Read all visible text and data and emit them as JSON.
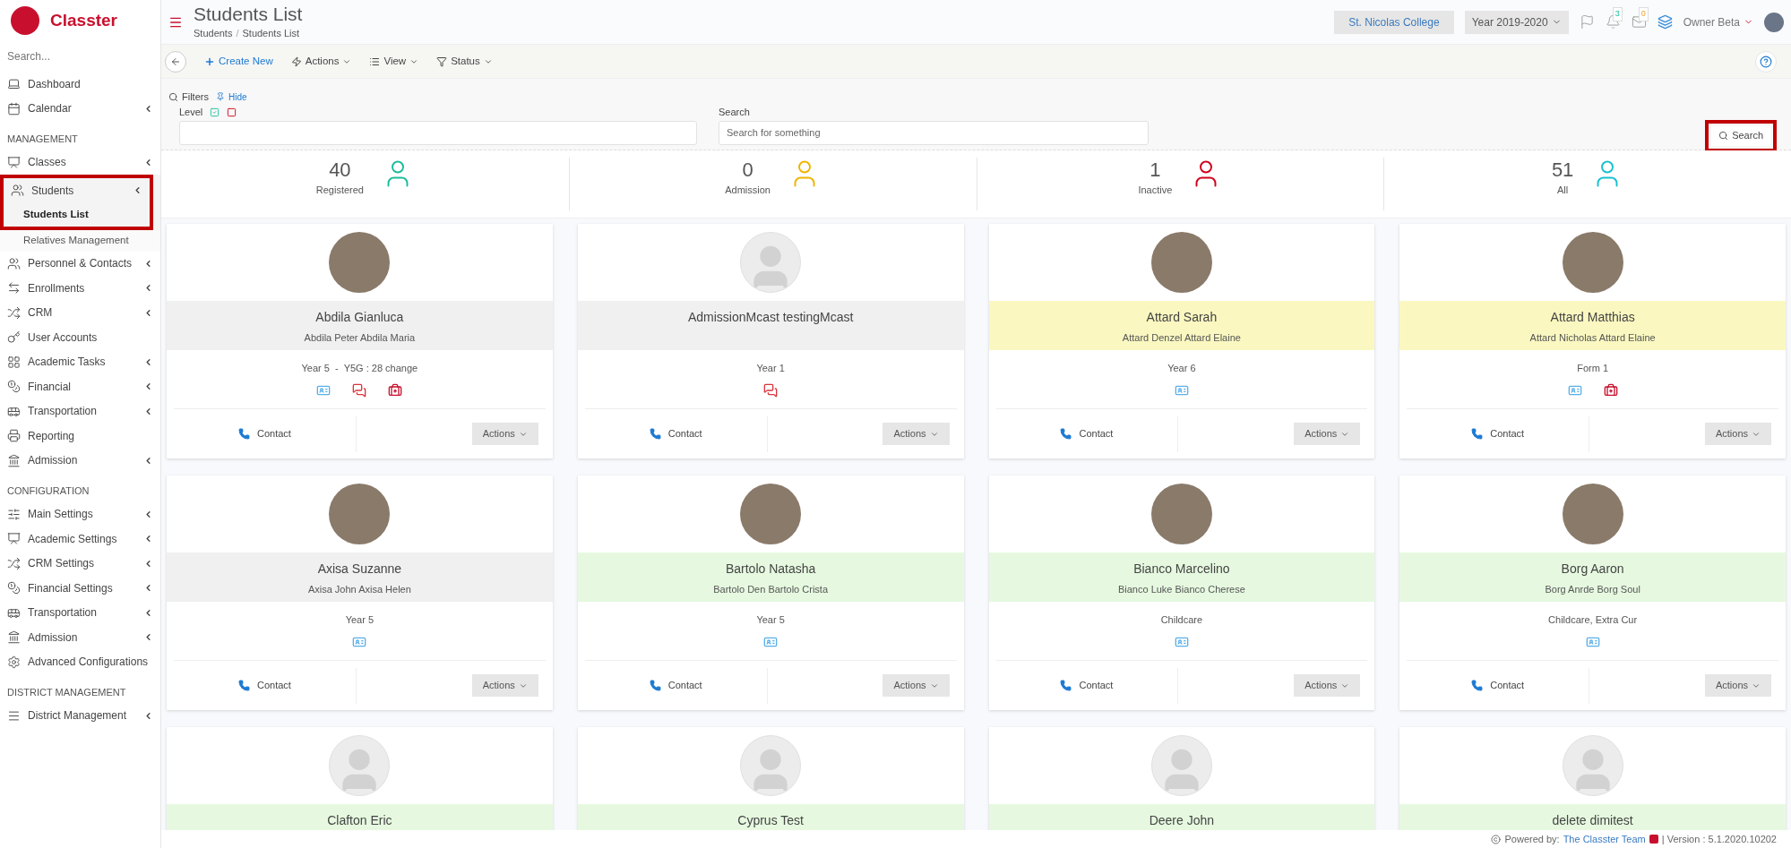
{
  "sidebar": {
    "brand": "Classter",
    "search_placeholder": "Search...",
    "sections": [
      {
        "items": [
          {
            "label": "Dashboard",
            "expandable": false
          },
          {
            "label": "Calendar",
            "expandable": true
          }
        ]
      },
      {
        "heading": "MANAGEMENT",
        "items": [
          {
            "label": "Classes",
            "expandable": true
          },
          {
            "label": "Students",
            "expandable": true,
            "highlighted": true,
            "children": [
              {
                "label": "Students List",
                "selected": true
              },
              {
                "label": "Relatives Management",
                "selected": false
              }
            ]
          },
          {
            "label": "Personnel & Contacts",
            "expandable": true
          },
          {
            "label": "Enrollments",
            "expandable": true
          },
          {
            "label": "CRM",
            "expandable": true
          },
          {
            "label": "User Accounts",
            "expandable": false
          },
          {
            "label": "Academic Tasks",
            "expandable": true
          },
          {
            "label": "Financial",
            "expandable": true
          },
          {
            "label": "Transportation",
            "expandable": true
          },
          {
            "label": "Reporting",
            "expandable": false
          },
          {
            "label": "Admission",
            "expandable": true
          }
        ]
      },
      {
        "heading": "CONFIGURATION",
        "items": [
          {
            "label": "Main Settings",
            "expandable": true
          },
          {
            "label": "Academic Settings",
            "expandable": true
          },
          {
            "label": "CRM Settings",
            "expandable": true
          },
          {
            "label": "Financial Settings",
            "expandable": true
          },
          {
            "label": "Transportation",
            "expandable": true
          },
          {
            "label": "Admission",
            "expandable": true
          },
          {
            "label": "Advanced Configurations",
            "expandable": false
          }
        ]
      },
      {
        "heading": "DISTRICT MANAGEMENT",
        "items": [
          {
            "label": "District Management",
            "expandable": true
          }
        ]
      }
    ]
  },
  "header": {
    "title": "Students List",
    "breadcrumb": [
      "Students",
      "Students List"
    ],
    "breadcrumb_separator": "/",
    "school": "St. Nicolas College",
    "year": "Year 2019-2020",
    "notifications": "3",
    "messages": "0",
    "user": "Owner Beta"
  },
  "toolbar": {
    "items": [
      "Create New",
      "Actions",
      "View",
      "Status"
    ]
  },
  "filters": {
    "title": "Filters",
    "hide": "Hide",
    "level_label": "Level",
    "search_label": "Search",
    "search_placeholder": "Search for something",
    "search_button": "Search",
    "search_highlighted": true
  },
  "stats": [
    {
      "value": "40",
      "label": "Registered",
      "color": "#1abc9c"
    },
    {
      "value": "0",
      "label": "Admission",
      "color": "#f0b400"
    },
    {
      "value": "1",
      "label": "Inactive",
      "color": "#d0021b"
    },
    {
      "value": "51",
      "label": "All",
      "color": "#17c1d0"
    }
  ],
  "cards": [
    {
      "name": "Abdila Gianluca",
      "guardians": "Abdila Peter Abdila Maria",
      "class": "Year 5  -  Y5G : 28 change",
      "photo": {
        "kind": "photo"
      },
      "color": "#f0f0f0",
      "icons": [
        {
          "kind": "id-card"
        },
        {
          "kind": "chat"
        },
        {
          "kind": "medical"
        }
      ],
      "contact": "Contact",
      "actions": "Actions"
    },
    {
      "name": "AdmissionMcast testingMcast",
      "class": "Year 1",
      "photo": {
        "kind": "placeholder"
      },
      "color": "#f0f0f0",
      "icons": [
        {
          "kind": "chat"
        }
      ],
      "contact": "Contact",
      "actions": "Actions"
    },
    {
      "name": "Attard Sarah",
      "guardians": "Attard Denzel Attard Elaine",
      "class": "Year 6",
      "photo": {
        "kind": "photo"
      },
      "color": "#faf8c0",
      "icons": [
        {
          "kind": "id-card"
        }
      ],
      "contact": "Contact",
      "actions": "Actions"
    },
    {
      "name": "Attard Matthias",
      "guardians": "Attard Nicholas Attard Elaine",
      "class": "Form 1",
      "photo": {
        "kind": "photo"
      },
      "color": "#faf8c0",
      "icons": [
        {
          "kind": "id-card"
        },
        {
          "kind": "medical"
        }
      ],
      "contact": "Contact",
      "actions": "Actions"
    },
    {
      "name": "Axisa Suzanne",
      "guardians": "Axisa John Axisa Helen",
      "class": "Year 5",
      "photo": {
        "kind": "photo"
      },
      "color": "#f0f0f0",
      "icons": [
        {
          "kind": "id-card"
        }
      ],
      "contact": "Contact",
      "actions": "Actions"
    },
    {
      "name": "Bartolo Natasha",
      "guardians": "Bartolo Den Bartolo Crista",
      "class": "Year 5",
      "photo": {
        "kind": "photo"
      },
      "color": "#e6f9e0",
      "icons": [
        {
          "kind": "id-card"
        }
      ],
      "contact": "Contact",
      "actions": "Actions"
    },
    {
      "name": "Bianco Marcelino",
      "guardians": "Bianco Luke Bianco Cherese",
      "class": "Childcare",
      "photo": {
        "kind": "photo"
      },
      "color": "#e6f9e0",
      "icons": [
        {
          "kind": "id-card"
        }
      ],
      "contact": "Contact",
      "actions": "Actions"
    },
    {
      "name": "Borg Aaron",
      "guardians": "Borg Anrde Borg Soul",
      "class": "Childcare, Extra Cur",
      "photo": {
        "kind": "photo"
      },
      "color": "#e6f9e0",
      "icons": [
        {
          "kind": "id-card"
        }
      ],
      "contact": "Contact",
      "actions": "Actions"
    },
    {
      "name": "Clafton Eric",
      "photo": {
        "kind": "placeholder"
      },
      "color": "#e6f9e0"
    },
    {
      "name": "Cyprus Test",
      "photo": {
        "kind": "placeholder"
      },
      "color": "#e6f9e0"
    },
    {
      "name": "Deere John",
      "photo": {
        "kind": "placeholder"
      },
      "color": "#e6f9e0"
    },
    {
      "name": "delete dimitest",
      "photo": {
        "kind": "placeholder"
      },
      "color": "#e6f9e0"
    }
  ],
  "footer": {
    "prefix": "Powered by:",
    "link": "The Classter Team",
    "version": "| Version : 5.1.2020.10202"
  }
}
